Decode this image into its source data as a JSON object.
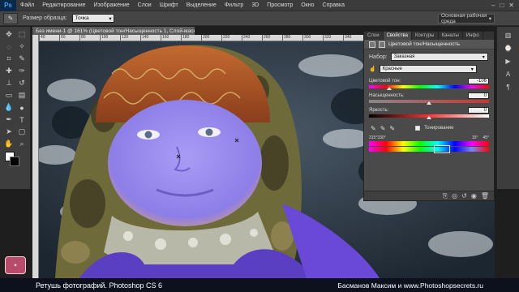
{
  "app": {
    "logo": "Ps"
  },
  "menu": [
    "Файл",
    "Редактирование",
    "Изображение",
    "Слои",
    "Шрифт",
    "Выделение",
    "Фильтр",
    "3D",
    "Просмотр",
    "Окно",
    "Справка"
  ],
  "options": {
    "sample_size_label": "Размер образца:",
    "sample_size_value": "Точка",
    "workspace": "Основная рабочая среда"
  },
  "document": {
    "tab_title": "Без имени-1 @ 161% (Цветовой тон/Насыщенность 1, Слой-маска/8) *"
  },
  "ruler_ticks": [
    "40",
    "60",
    "80",
    "100",
    "120",
    "140",
    "160",
    "180",
    "200",
    "220",
    "240",
    "260",
    "280",
    "300",
    "320",
    "340"
  ],
  "panel": {
    "tabs": [
      "Слои",
      "Свойства",
      "Контуры",
      "Каналы",
      "Инфо"
    ],
    "active_tab": "Свойства",
    "title": "Цветовой тон/Насыщенность",
    "preset_label": "Набор:",
    "preset_value": "Заказная",
    "channel_value": "Красные",
    "hue_label": "Цветовой тон:",
    "hue_value": "-106",
    "hue_thumb_pct": 17,
    "saturation_label": "Насыщенность:",
    "saturation_value": "0",
    "saturation_thumb_pct": 50,
    "lightness_label": "Яркость:",
    "lightness_value": "0",
    "lightness_thumb_pct": 50,
    "colorize_label": "Тонирование",
    "range_labels": {
      "left1": "315°",
      "left2": "330°",
      "right1": "15°",
      "right2": "45°"
    }
  },
  "caption": {
    "left": "Ретушь фотографий.  Photoshop CS 6",
    "right": "Басманов Максим и www.Photoshopsecrets.ru"
  },
  "colors": {
    "accent": "#3fa0f0",
    "skin_tint": "#9a8cf0",
    "hat": "#c0642c"
  }
}
